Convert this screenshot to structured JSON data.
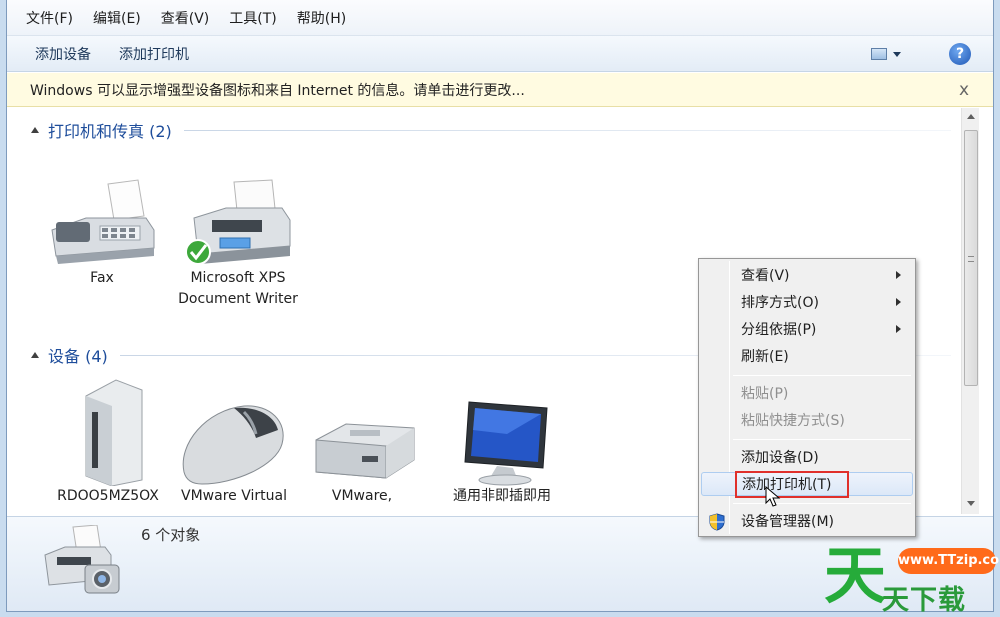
{
  "menubar": {
    "items": [
      "文件(F)",
      "编辑(E)",
      "查看(V)",
      "工具(T)",
      "帮助(H)"
    ]
  },
  "toolbar": {
    "add_device": "添加设备",
    "add_printer": "添加打印机",
    "help_label": "?"
  },
  "infobar": {
    "message": "Windows 可以显示增强型设备图标和来自 Internet 的信息。请单击进行更改...",
    "close_label": "x"
  },
  "groups": {
    "printers": {
      "title": "打印机和传真 (2)",
      "items": [
        {
          "label": "Fax",
          "icon": "fax-icon"
        },
        {
          "label": "Microsoft XPS Document Writer",
          "icon": "printer-icon",
          "default": true
        }
      ]
    },
    "devices": {
      "title": "设备 (4)",
      "items": [
        {
          "label": "RDOO5MZ5OX",
          "icon": "computer-tower-icon"
        },
        {
          "label": "VMware Virtual",
          "icon": "mouse-icon"
        },
        {
          "label": "VMware,",
          "icon": "drive-icon"
        },
        {
          "label": "通用非即插即用",
          "icon": "monitor-icon"
        }
      ]
    }
  },
  "details": {
    "count": "6 个对象",
    "icon": "printer-camera-icon"
  },
  "context_menu": {
    "items": [
      {
        "label": "查看(V)",
        "submenu": true,
        "disabled": false
      },
      {
        "label": "排序方式(O)",
        "submenu": true,
        "disabled": false
      },
      {
        "label": "分组依据(P)",
        "submenu": true,
        "disabled": false
      },
      {
        "label": "刷新(E)",
        "submenu": false,
        "disabled": false
      },
      {
        "label": "粘贴(P)",
        "submenu": false,
        "disabled": true
      },
      {
        "label": "粘贴快捷方式(S)",
        "submenu": false,
        "disabled": true
      },
      {
        "label": "添加设备(D)",
        "submenu": false,
        "disabled": false
      },
      {
        "label": "添加打印机(T)",
        "submenu": false,
        "disabled": false,
        "hovered": true
      },
      {
        "label": "设备管理器(M)",
        "submenu": false,
        "disabled": false,
        "icon": "shield-icon"
      }
    ],
    "highlight_color": "#e0302b"
  },
  "watermark": {
    "big": "天",
    "url": "www.TTzip.com",
    "sub": "天下载",
    "green": "#26ab3a",
    "orange": "#ff6a1a"
  }
}
